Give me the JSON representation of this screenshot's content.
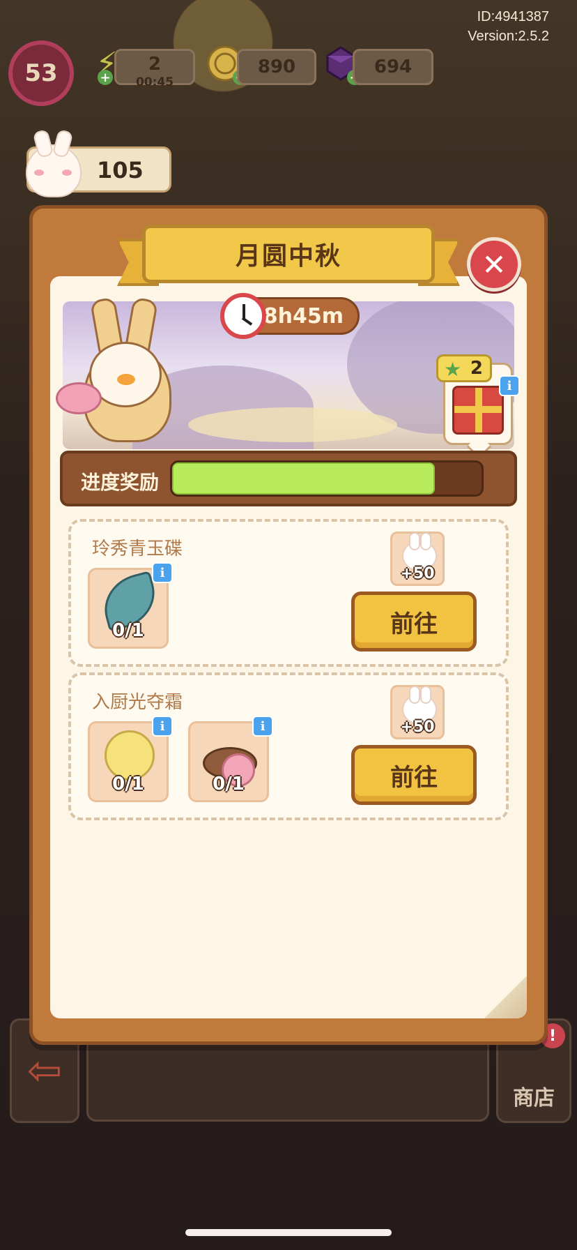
{
  "system": {
    "id_text": "ID:4941387",
    "version_text": "Version:2.5.2"
  },
  "hud": {
    "level": "53",
    "energy": {
      "value": "2",
      "timer": "00:45",
      "icon": "lightning-icon"
    },
    "coins": {
      "value": "890",
      "icon": "coin-icon"
    },
    "gems": {
      "value": "694",
      "icon": "gem-icon"
    }
  },
  "rabbit_counter": {
    "value": "105",
    "icon": "rabbit-icon"
  },
  "modal": {
    "title": "月圆中秋",
    "close_icon": "close-icon",
    "timer": "8h45m",
    "reward_preview": {
      "stars": "2",
      "icon": "gift-box-icon"
    },
    "progress": {
      "label": "进度奖励",
      "fraction": 0.85,
      "fill_color": "#b8ec5c"
    },
    "tasks": [
      {
        "title": "玲秀青玉碟",
        "items": [
          {
            "icon": "jade-leaf-dish-icon",
            "count": "0/1"
          }
        ],
        "reward": {
          "icon": "rabbit-icon",
          "amount": "+50"
        },
        "button_label": "前往"
      },
      {
        "title": "入厨光夺霜",
        "items": [
          {
            "icon": "moon-icon",
            "count": "0/1"
          },
          {
            "icon": "mooncake-icon",
            "count": "0/1"
          }
        ],
        "reward": {
          "icon": "rabbit-icon",
          "amount": "+50"
        },
        "button_label": "前往"
      }
    ]
  },
  "bottom": {
    "shop_label": "商店",
    "shop_badge": "!"
  }
}
